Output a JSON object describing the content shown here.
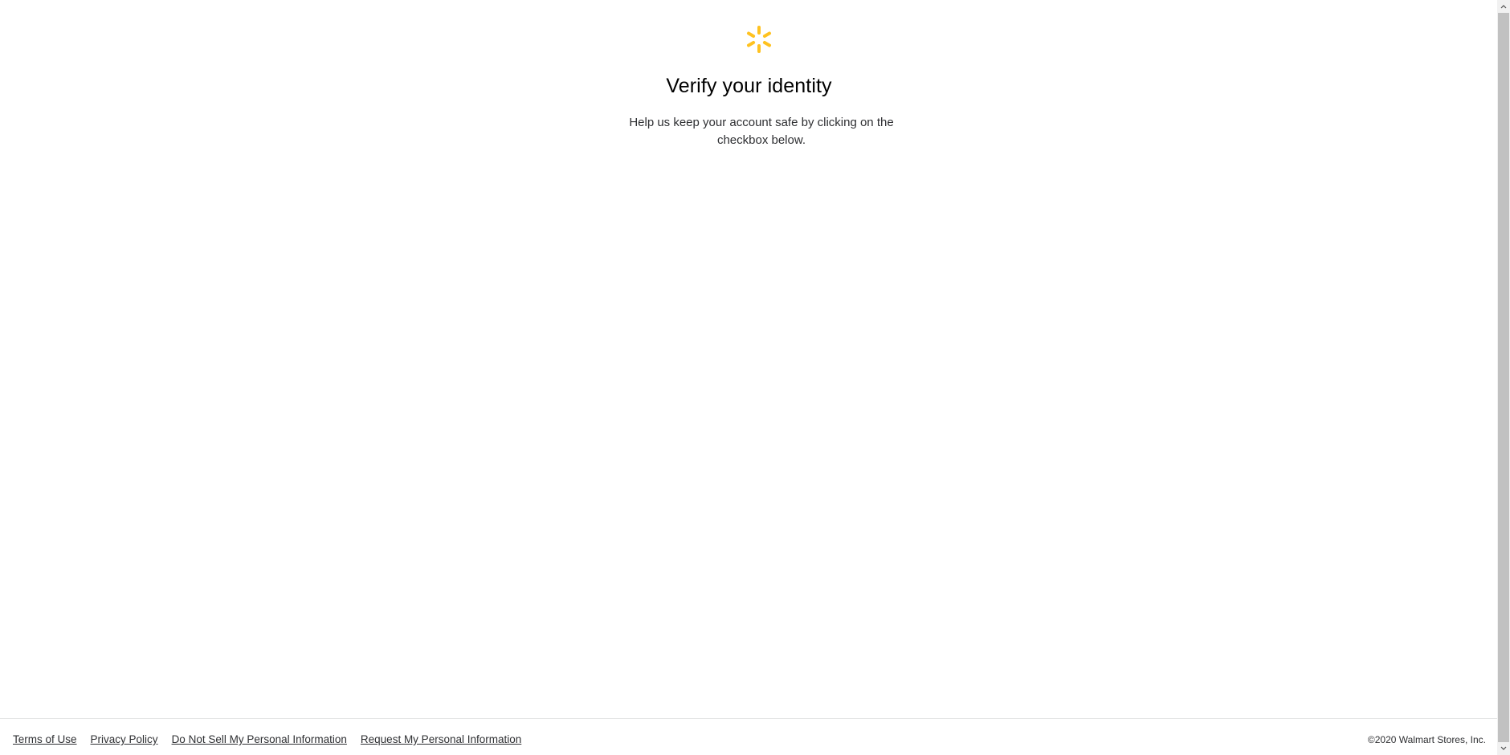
{
  "page": {
    "title": "Verify your identity",
    "subtitle": "Help us keep your account safe by clicking on the checkbox below.",
    "brand_color": "#ffc220",
    "logo_icon": "walmart-spark-icon"
  },
  "footer": {
    "links": [
      {
        "label": "Terms of Use"
      },
      {
        "label": "Privacy Policy"
      },
      {
        "label": "Do Not Sell My Personal Information"
      },
      {
        "label": "Request My Personal Information"
      }
    ],
    "copyright": "©2020 Walmart Stores, Inc."
  },
  "scrollbar": {
    "up_icon": "chevron-up-icon",
    "down_icon": "chevron-down-icon"
  }
}
